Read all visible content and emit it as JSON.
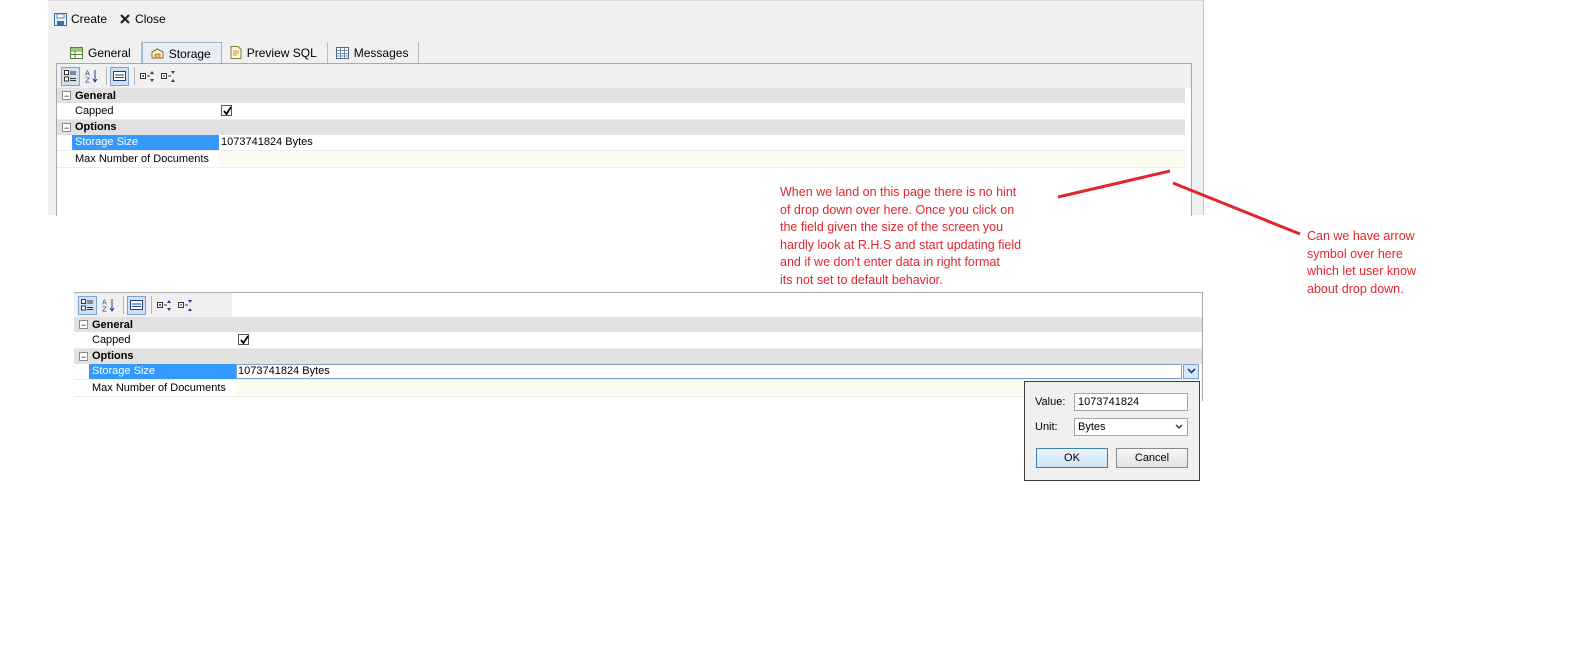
{
  "toolbar": {
    "create_label": "Create",
    "close_label": "Close"
  },
  "tabs": [
    {
      "label": "General",
      "icon": "table-icon"
    },
    {
      "label": "Storage",
      "icon": "storage-icon",
      "active": true
    },
    {
      "label": "Preview SQL",
      "icon": "sql-icon"
    },
    {
      "label": "Messages",
      "icon": "grid-icon"
    }
  ],
  "property_tools": [
    "categorized-icon",
    "alphabetical-icon",
    "description-icon",
    "expand-all-icon",
    "collapse-all-icon"
  ],
  "grid": {
    "general_category": "General",
    "capped_label": "Capped",
    "capped_checked": true,
    "options_category": "Options",
    "storage_size_label": "Storage Size",
    "storage_size_value": "1073741824 Bytes",
    "max_docs_label": "Max Number of Documents",
    "max_docs_value": ""
  },
  "popup": {
    "value_label": "Value:",
    "value": "1073741824",
    "unit_label": "Unit:",
    "unit_value": "Bytes",
    "ok_label": "OK",
    "cancel_label": "Cancel"
  },
  "annotations": {
    "note1": "When we land on this page there is no hint\nof drop down over here. Once you click on\nthe field given the size of the screen you\nhardly look at R.H.S and start updating field\nand if we don't enter data in right format\nits not set to default behavior.",
    "note2": "Can we have arrow\nsymbol over here\nwhich let user know\nabout drop down.",
    "color": "#e0262f"
  }
}
